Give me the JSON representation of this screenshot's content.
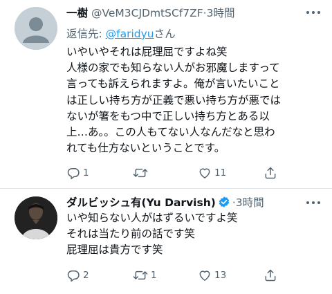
{
  "tweets": [
    {
      "display_name": "一樹",
      "handle": "@VeM3CJDmtSCf7ZF",
      "time": "3時間",
      "reply_prefix": "返信先: ",
      "reply_handle": "@faridyu",
      "reply_suffix": "さん",
      "lines": [
        "いやいやそれは屁理屈ですよね笑",
        "人様の家でも知らない人がお邪魔しますって",
        "言っても訴えられますよ。俺が言いたいこと",
        "は正しい持ち方が正義で悪い持ち方が悪では",
        "ないが箸をもつ中で正しい持ち方とある以",
        "上…あ。。この人もてない人なんだなと思わ",
        "れても仕方ないということです。"
      ],
      "reply_count": "1",
      "retweet_count": "",
      "like_count": "11"
    },
    {
      "display_name": "ダルビッシュ有(Yu Darvish)",
      "time": "3時間",
      "lines": [
        "いや知らない人がはずるいですよ笑",
        "それは当たり前の話です笑",
        "屁理屈は貴方です笑"
      ],
      "reply_count": "2",
      "retweet_count": "1",
      "like_count": "13"
    }
  ],
  "icons": {
    "more": "more-icon",
    "reply": "reply-icon",
    "retweet": "retweet-icon",
    "like": "like-icon",
    "share": "share-icon",
    "verified": "verified-badge-icon"
  },
  "colors": {
    "text": "#0f1419",
    "secondary": "#536471",
    "link": "#1d9bf0",
    "verified": "#1d9bf0"
  }
}
